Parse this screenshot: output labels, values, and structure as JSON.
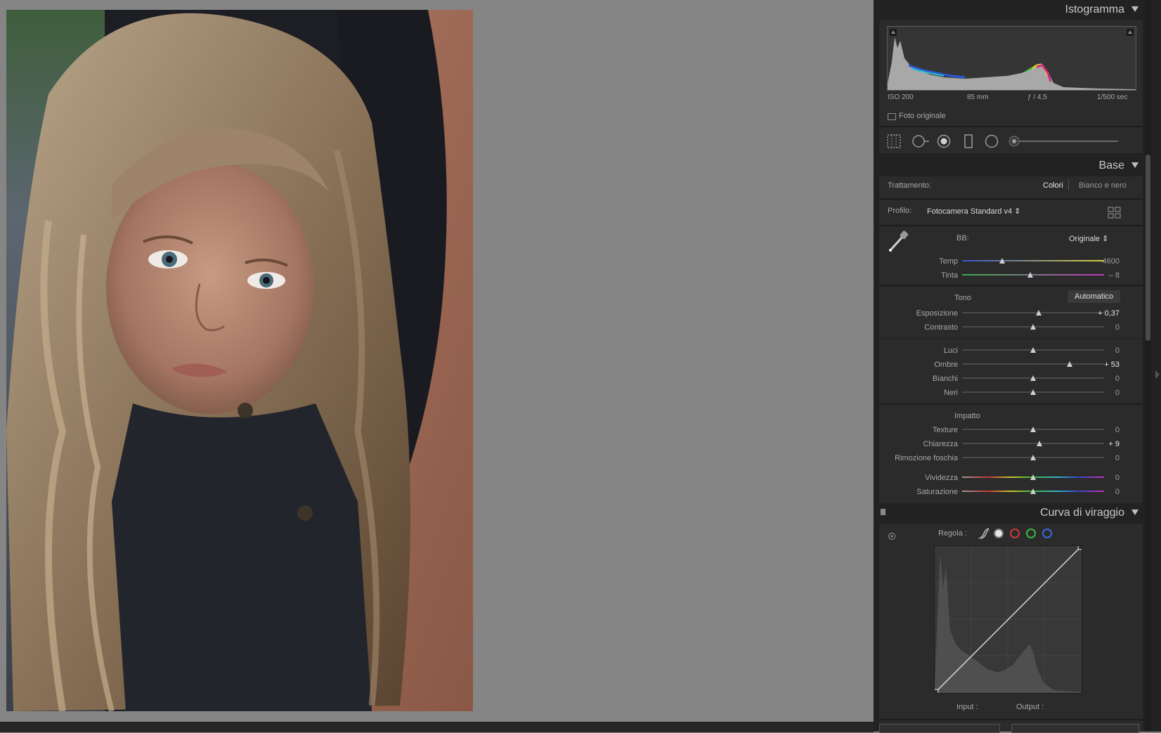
{
  "photo": {
    "subject": "portrait-photo"
  },
  "panels": {
    "histogram": {
      "title": "Istogramma",
      "meta": {
        "iso": "ISO 200",
        "focal": "85 mm",
        "aperture": "ƒ / 4,5",
        "shutter": "1/500 sec"
      },
      "original_photo_label": "Foto originale"
    },
    "base": {
      "title": "Base",
      "treatment": {
        "label": "Trattamento:",
        "options": [
          "Colori",
          "Bianco e nero"
        ],
        "selected": "Colori"
      },
      "profile": {
        "label": "Profilo:",
        "value": "Fotocamera Standard v4 ⇕"
      },
      "wb": {
        "label": "BB:",
        "value": "Originale ⇕",
        "sliders": [
          {
            "name": "Temp",
            "value": "4600",
            "pos": 0.28
          },
          {
            "name": "Tinta",
            "value": "– 8",
            "pos": 0.48
          }
        ]
      },
      "tone": {
        "label": "Tono",
        "auto_button": "Automatico",
        "sliders": [
          {
            "name": "Esposizione",
            "value": "+ 0,37",
            "pos": 0.54,
            "bright": true
          },
          {
            "name": "Contrasto",
            "value": "0",
            "pos": 0.5
          },
          {
            "name": "Luci",
            "value": "0",
            "pos": 0.5
          },
          {
            "name": "Ombre",
            "value": "+ 53",
            "pos": 0.755,
            "bright": true
          },
          {
            "name": "Bianchi",
            "value": "0",
            "pos": 0.5
          },
          {
            "name": "Neri",
            "value": "0",
            "pos": 0.5
          }
        ]
      },
      "presence": {
        "label": "Impatto",
        "sliders": [
          {
            "name": "Texture",
            "value": "0",
            "pos": 0.5
          },
          {
            "name": "Chiarezza",
            "value": "+ 9",
            "pos": 0.545,
            "bright": true
          },
          {
            "name": "Rimozione foschia",
            "value": "0",
            "pos": 0.5
          },
          {
            "name": "Vividezza",
            "value": "0",
            "pos": 0.5
          },
          {
            "name": "Saturazione",
            "value": "0",
            "pos": 0.5
          }
        ]
      }
    },
    "tone_curve": {
      "title": "Curva di viraggio",
      "adjust_label": "Regola :",
      "input_label": "Input :",
      "output_label": "Output :"
    }
  },
  "colors": {
    "panel_bg": "#2b2b2b",
    "header_bg": "#222222",
    "canvas_bg": "#858585"
  }
}
